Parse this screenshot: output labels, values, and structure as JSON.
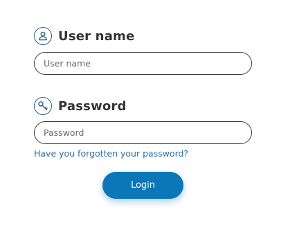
{
  "username": {
    "label": "User name",
    "placeholder": "User name",
    "value": "",
    "icon": "user-icon"
  },
  "password": {
    "label": "Password",
    "placeholder": "Password",
    "value": "",
    "icon": "key-icon"
  },
  "forgot_link": "Have you forgotten your password?",
  "login_button": "Login",
  "colors": {
    "accent": "#0b76b8",
    "link": "#2a6fa3",
    "icon": "#2b5f86",
    "label": "#333333"
  }
}
